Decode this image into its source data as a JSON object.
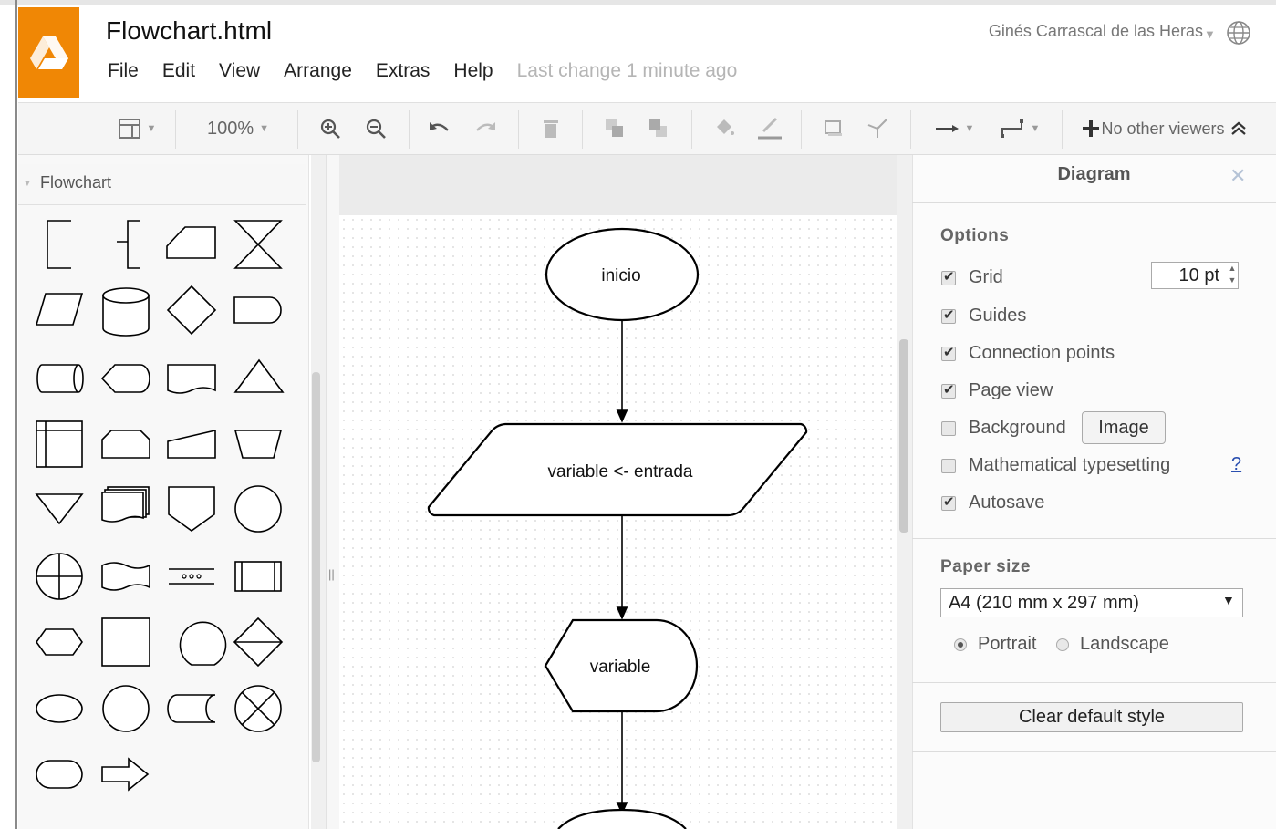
{
  "app": {
    "file_title": "Flowchart.html",
    "user_name": "Ginés Carrascal de las Heras",
    "last_change": "Last change 1 minute ago",
    "brand_color": "#f08705"
  },
  "menu": [
    "File",
    "Edit",
    "View",
    "Arrange",
    "Extras",
    "Help"
  ],
  "toolbar": {
    "zoom": "100%",
    "viewers": "No other viewers",
    "icons": [
      "format-panel-icon",
      "zoom-in-icon",
      "zoom-out-icon",
      "undo-icon",
      "redo-icon",
      "delete-icon",
      "to-front-icon",
      "to-back-icon",
      "fill-color-icon",
      "line-color-icon",
      "shadow-icon",
      "waypoints-icon",
      "connection-icon",
      "waypoint-style-icon",
      "collapse-icon"
    ]
  },
  "left_panel": {
    "section": "Flowchart",
    "shapes": [
      "annotation-1",
      "annotation-2",
      "card",
      "collate",
      "data",
      "database",
      "decision",
      "delay",
      "direct-data",
      "display",
      "document",
      "extract",
      "internal-storage",
      "loop-limit",
      "manual-input",
      "manual-operation",
      "merge",
      "multi-document",
      "off-page-reference",
      "on-page-reference",
      "or",
      "paper-tape",
      "parallel-mode",
      "predefined-process",
      "preparation",
      "process",
      "sequential-data",
      "sort",
      "start-1",
      "start-2",
      "stored-data",
      "summing-function",
      "terminator",
      "transfer"
    ]
  },
  "diagram": {
    "nodes": [
      {
        "label": "inicio",
        "shape": "ellipse"
      },
      {
        "label": "variable <- entrada",
        "shape": "parallelogram"
      },
      {
        "label": "variable",
        "shape": "display"
      }
    ]
  },
  "format_panel": {
    "title": "Diagram",
    "options_title": "Options",
    "options": [
      {
        "label": "Grid",
        "checked": true
      },
      {
        "label": "Guides",
        "checked": true
      },
      {
        "label": "Connection points",
        "checked": true
      },
      {
        "label": "Page view",
        "checked": true
      },
      {
        "label": "Background",
        "checked": false
      },
      {
        "label": "Mathematical typesetting",
        "checked": false
      },
      {
        "label": "Autosave",
        "checked": true
      }
    ],
    "grid_size": "10 pt",
    "image_button": "Image",
    "help_link": "?",
    "paper_title": "Paper size",
    "paper_value": "A4 (210 mm x 297 mm)",
    "portrait": "Portrait",
    "landscape": "Landscape",
    "orientation": "portrait",
    "clear_button": "Clear default style"
  }
}
